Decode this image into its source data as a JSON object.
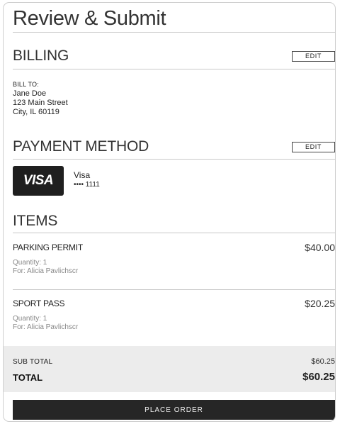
{
  "page": {
    "title": "Review & Submit"
  },
  "billing": {
    "heading": "BILLING",
    "edit_label": "EDIT",
    "bill_to_label": "BILL TO:",
    "name": "Jane Doe",
    "street": "123 Main Street",
    "city_line": "City, IL 60119"
  },
  "payment": {
    "heading": "PAYMENT METHOD",
    "edit_label": "EDIT",
    "badge_text": "VISA",
    "brand": "Visa",
    "masked_number": "•••• 1111"
  },
  "items": {
    "heading": "ITEMS",
    "list": [
      {
        "name": "PARKING PERMIT",
        "price": "$40.00",
        "quantity": "Quantity: 1",
        "for": "For: Alicia Pavlichscr"
      },
      {
        "name": "SPORT PASS",
        "price": "$20.25",
        "quantity": "Quantity: 1",
        "for": "For: Alicia Pavlichscr"
      }
    ]
  },
  "totals": {
    "subtotal_label": "SUB TOTAL",
    "subtotal_value": "$60.25",
    "total_label": "TOTAL",
    "total_value": "$60.25"
  },
  "actions": {
    "place_order_label": "PLACE ORDER"
  }
}
